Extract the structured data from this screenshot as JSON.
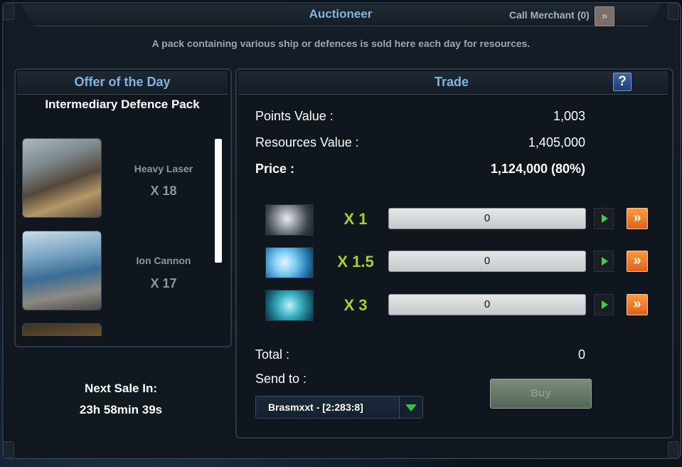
{
  "window": {
    "title": "Auctioneer",
    "call_merchant_label": "Call Merchant (0)",
    "description": "A pack containing various ship or defences is sold here each day for resources."
  },
  "offer": {
    "title": "Offer of the Day",
    "pack_name": "Intermediary Defence Pack",
    "items": [
      {
        "name": "Heavy Laser",
        "quantity": "X 18"
      },
      {
        "name": "Ion Cannon",
        "quantity": "X 17"
      }
    ],
    "next_sale_label": "Next Sale In:",
    "next_sale_time": "23h 58min 39s"
  },
  "trade": {
    "title": "Trade",
    "help_label": "?",
    "points_label": "Points Value :",
    "points_value": "1,003",
    "resources_label": "Resources Value :",
    "resources_value": "1,405,000",
    "price_label": "Price :",
    "price_value": "1,124,000 (80%)",
    "resources": [
      {
        "icon": "metal-icon",
        "multiplier": "X 1",
        "value": "0"
      },
      {
        "icon": "crystal-icon",
        "multiplier": "X 1.5",
        "value": "0"
      },
      {
        "icon": "deuterium-icon",
        "multiplier": "X 3",
        "value": "0"
      }
    ],
    "total_label": "Total :",
    "total_value": "0",
    "send_to_label": "Send to :",
    "destination": "Brasmxxt - [2:283:8]",
    "buy_label": "Buy"
  },
  "colors": {
    "title_blue": "#7fb5de",
    "multiplier_green": "#a8d221",
    "max_orange": "#f07a25"
  }
}
